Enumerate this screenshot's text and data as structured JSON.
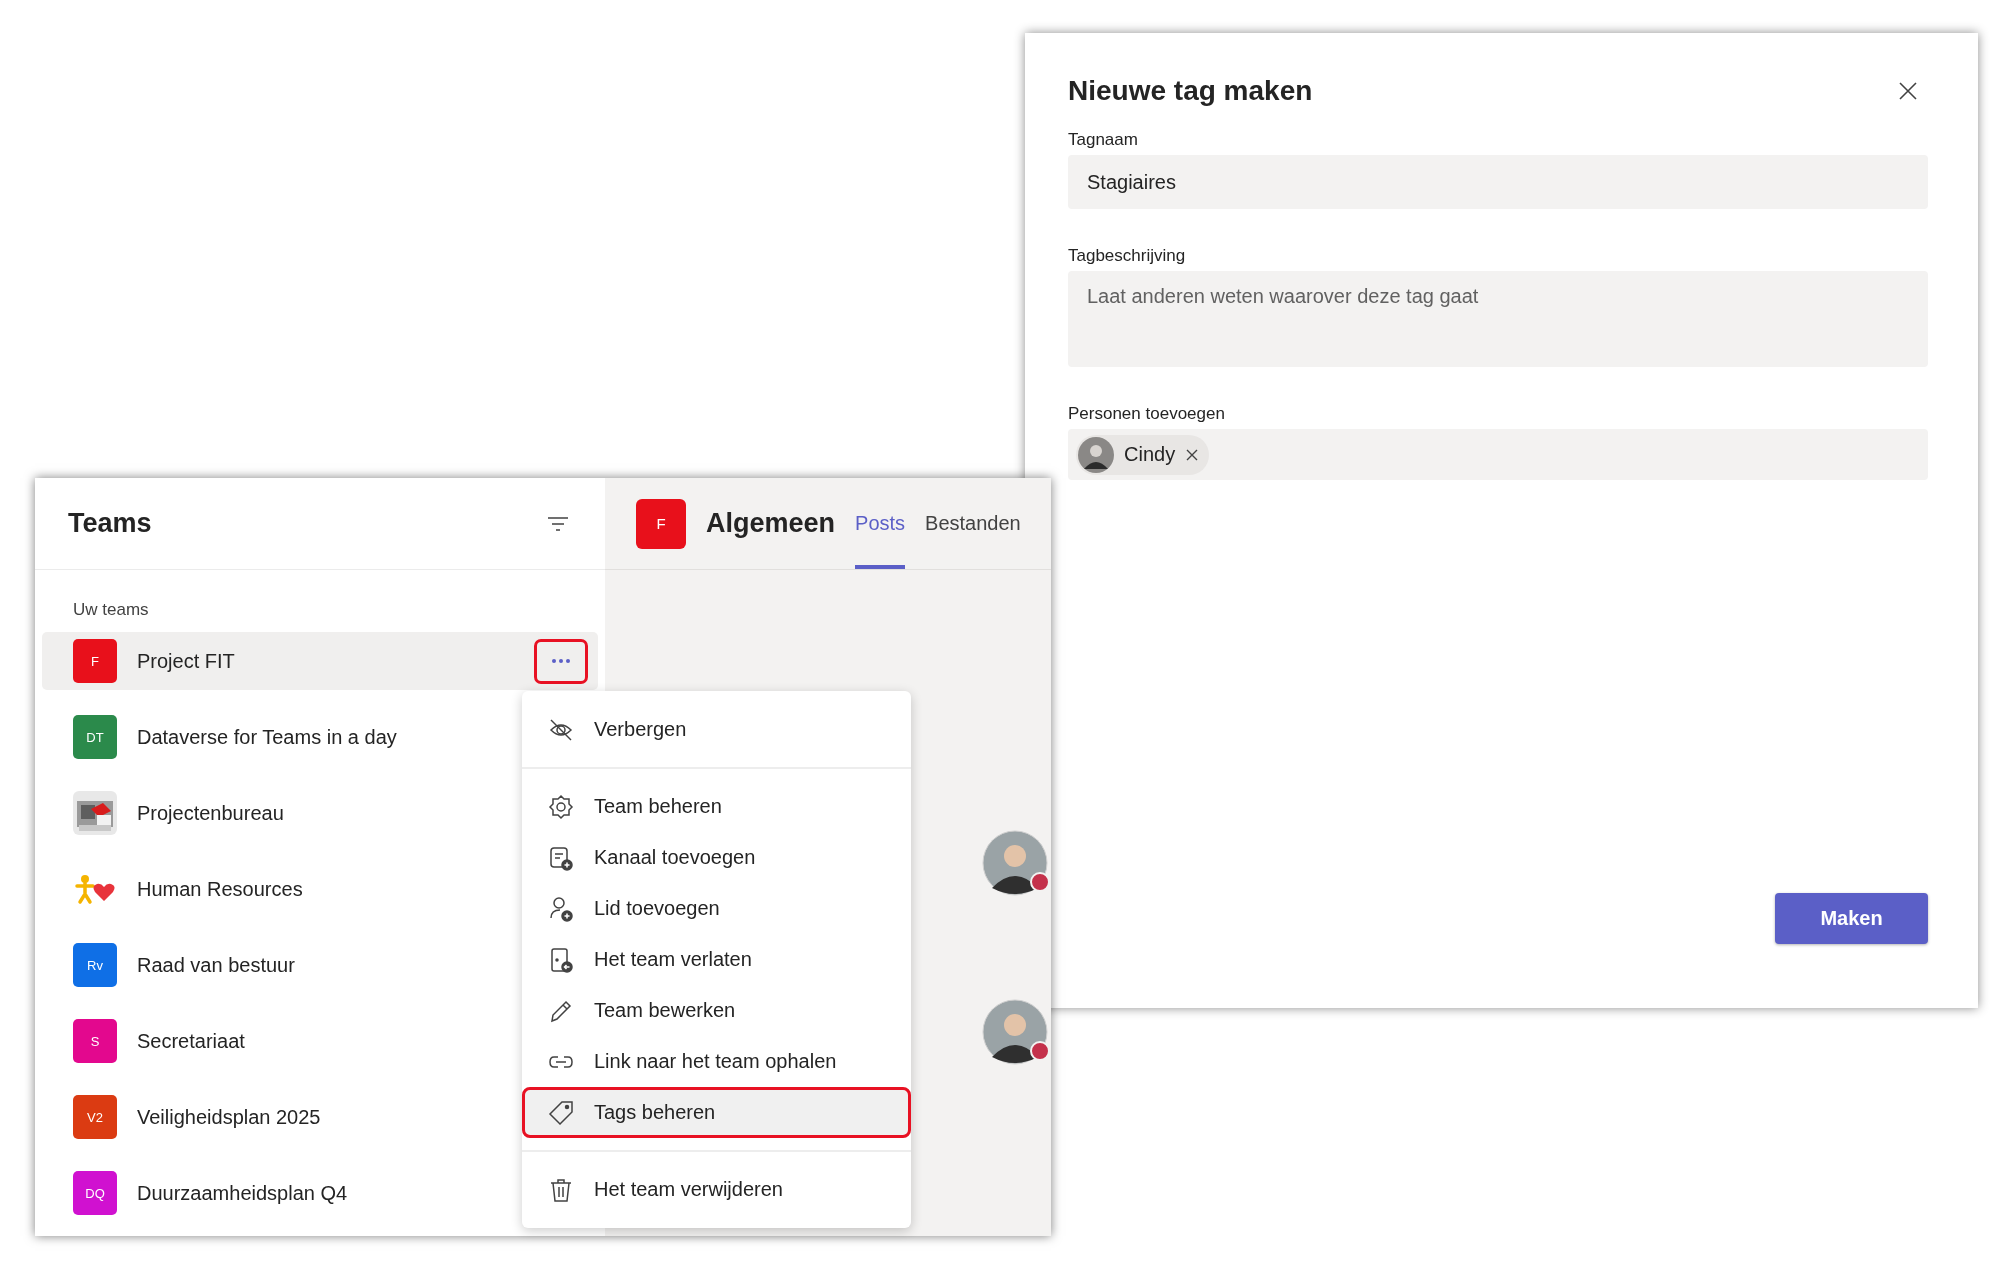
{
  "dialog": {
    "title": "Nieuwe tag maken",
    "fields": [
      {
        "kind": "input",
        "label": "Tagnaam",
        "value": "Stagiaires"
      },
      {
        "kind": "textarea",
        "label": "Tagbeschrijving",
        "placeholder": "Laat anderen weten waarover deze tag gaat"
      },
      {
        "kind": "people",
        "label": "Personen toevoegen",
        "people": [
          {
            "name": "Cindy"
          }
        ]
      }
    ],
    "primary_button": "Maken"
  },
  "teams_panel": {
    "title": "Teams",
    "section": "Uw teams",
    "more_button": {
      "highlighted": true
    },
    "teams": [
      {
        "name": "Project FIT",
        "avatar": {
          "kind": "initials",
          "initials": "F",
          "color": "#e8101b"
        },
        "selected": true
      },
      {
        "name": "Dataverse for Teams in a day",
        "avatar": {
          "kind": "initials",
          "initials": "DT",
          "color": "#2b8a4b"
        },
        "selected": false
      },
      {
        "name": "Projectenbureau",
        "selected": false
      },
      {
        "name": "Human Resources",
        "avatar": {
          "kind": "emoji"
        },
        "selected": false
      },
      {
        "name": "Raad van bestuur",
        "avatar": {
          "kind": "initials",
          "initials": "Rv",
          "color": "#0f6fe6"
        },
        "selected": false
      },
      {
        "name": "Secretariaat",
        "avatar": {
          "kind": "initials",
          "initials": "S",
          "color": "#e3088e"
        },
        "selected": false
      },
      {
        "name": "Veiligheidsplan 2025",
        "avatar": {
          "kind": "initials",
          "initials": "V2",
          "color": "#db3b12"
        },
        "selected": false
      },
      {
        "name": "Duurzaamheidsplan Q4",
        "avatar": {
          "kind": "initials",
          "initials": "DQ",
          "color": "#d011d0"
        },
        "selected": false
      }
    ]
  },
  "channel": {
    "avatar": {
      "initials": "F",
      "color": "#e8101b"
    },
    "name": "Algemeen",
    "tabs": [
      {
        "label": "Posts",
        "selected": true
      },
      {
        "label": "Bestanden",
        "selected": false
      }
    ],
    "feed_avatars": [
      {
        "busy": true
      },
      {
        "busy": true
      }
    ]
  },
  "context_menu": {
    "groups": [
      [
        {
          "label": "Verbergen",
          "selected": false
        }
      ],
      [
        {
          "label": "Team beheren",
          "selected": false
        },
        {
          "label": "Kanaal toevoegen",
          "selected": false
        },
        {
          "label": "Lid toevoegen",
          "selected": false
        },
        {
          "label": "Het team verlaten",
          "selected": false
        },
        {
          "label": "Team bewerken",
          "selected": false
        },
        {
          "label": "Link naar het team ophalen",
          "selected": false
        },
        {
          "label": "Tags beheren",
          "selected": true
        }
      ],
      [
        {
          "label": "Het team verwijderen",
          "selected": false
        }
      ]
    ]
  }
}
